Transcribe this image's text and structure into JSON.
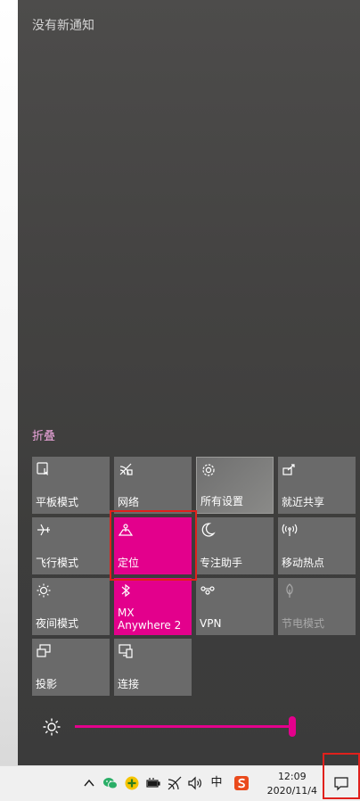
{
  "notifications": {
    "empty_text": "没有新通知"
  },
  "collapse_label": "折叠",
  "tiles": [
    {
      "label": "平板模式",
      "state": "off",
      "icon": "tablet-mode-icon"
    },
    {
      "label": "网络",
      "state": "off",
      "icon": "network-icon"
    },
    {
      "label": "所有设置",
      "state": "off",
      "icon": "gear-icon"
    },
    {
      "label": "就近共享",
      "state": "off",
      "icon": "nearby-share-icon"
    },
    {
      "label": "飞行模式",
      "state": "off",
      "icon": "airplane-icon"
    },
    {
      "label": "定位",
      "state": "on",
      "icon": "location-icon"
    },
    {
      "label": "专注助手",
      "state": "off",
      "icon": "moon-icon"
    },
    {
      "label": "移动热点",
      "state": "off",
      "icon": "hotspot-icon"
    },
    {
      "label": "夜间模式",
      "state": "off",
      "icon": "night-light-icon"
    },
    {
      "label": "MX Anywhere 2",
      "state": "on",
      "icon": "bluetooth-icon"
    },
    {
      "label": "VPN",
      "state": "off",
      "icon": "vpn-icon"
    },
    {
      "label": "节电模式",
      "state": "disabled",
      "icon": "battery-saver-icon"
    },
    {
      "label": "投影",
      "state": "off",
      "icon": "project-icon"
    },
    {
      "label": "连接",
      "state": "off",
      "icon": "connect-icon"
    }
  ],
  "brightness": {
    "value": 100
  },
  "taskbar": {
    "ime_label": "中",
    "time": "12:09",
    "date": "2020/11/4"
  },
  "colors": {
    "accent": "#e3008c",
    "highlight": "#e0201c",
    "panel": "#434241",
    "tile": "#6a6a6a"
  }
}
